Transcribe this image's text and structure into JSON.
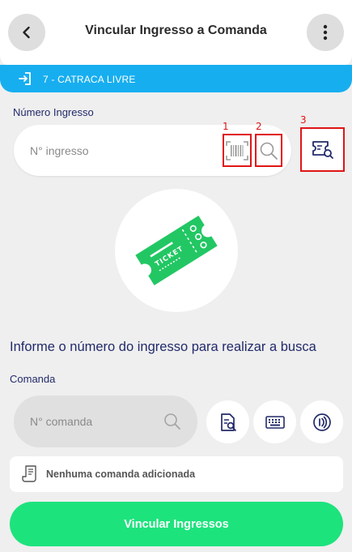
{
  "header": {
    "title": "Vincular Ingresso a Comanda"
  },
  "banner": {
    "text": "7 - CATRACA LIVRE"
  },
  "ingresso": {
    "label": "Número Ingresso",
    "placeholder": "N° ingresso",
    "markers": [
      "1",
      "2",
      "3"
    ]
  },
  "info_text": "Informe o número do ingresso para realizar a busca",
  "ticket_image_text": "TICKET",
  "comanda": {
    "label": "Comanda",
    "placeholder": "N° comanda",
    "empty_text": "Nenhuma comanda adicionada"
  },
  "actions": {
    "vincular_label": "Vincular Ingressos"
  },
  "colors": {
    "accent_blue": "#17aef0",
    "navy": "#222a6a",
    "green": "#1de37d",
    "annotation_red": "#e01515"
  },
  "icons": [
    "chevron-left-icon",
    "more-vertical-icon",
    "exit-door-icon",
    "barcode-icon",
    "search-icon",
    "ticket-search-icon",
    "ticket-icon",
    "document-search-icon",
    "keyboard-icon",
    "nfc-icon",
    "receipt-icon"
  ]
}
